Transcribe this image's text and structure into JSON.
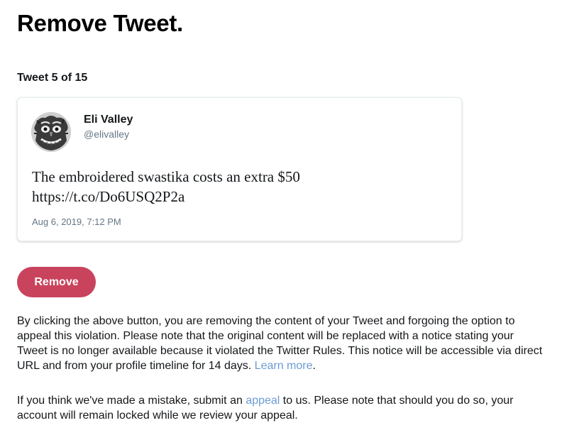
{
  "page": {
    "title": "Remove Tweet.",
    "counter": "Tweet 5 of 15"
  },
  "tweet": {
    "author_name": "Eli Valley",
    "author_handle": "@elivalley",
    "text_line1": "The embroidered swastika costs an extra $50",
    "text_line2": "https://t.co/Do6USQ2P2a",
    "timestamp": "Aug 6, 2019, 7:12 PM"
  },
  "actions": {
    "remove_label": "Remove",
    "remove_color": "#c9435d"
  },
  "info": {
    "para1_text": "By clicking the above button, you are removing the content of your Tweet and forgoing the option to appeal this violation. Please note that the original content will be replaced with a notice stating your Tweet is no longer available because it violated the Twitter Rules. This notice will be accessible via direct URL and from your profile timeline for 14 days. ",
    "learn_more_label": "Learn more",
    "para1_end": ".",
    "para2_start": "If you think we've made a mistake, submit an ",
    "appeal_label": "appeal",
    "para2_end": " to us. Please note that should you do so, your account will remain locked while we review your appeal.",
    "link_color": "#6c9bd2"
  }
}
